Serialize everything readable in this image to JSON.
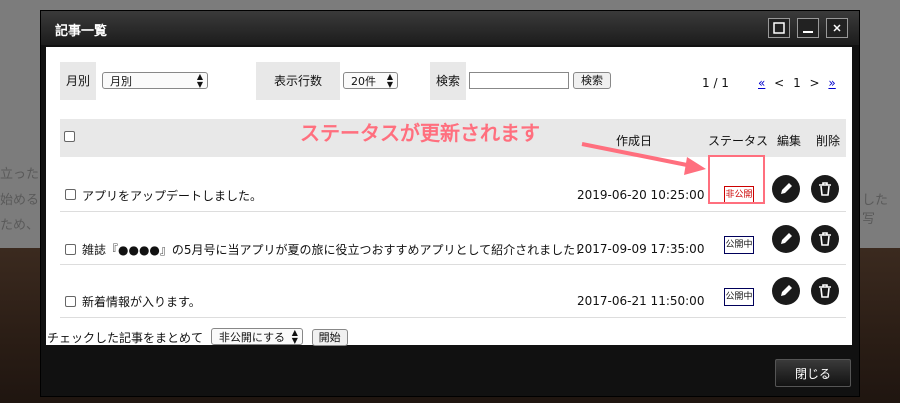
{
  "dialog": {
    "title": "記事一覧",
    "close_button": "閉じる",
    "window_buttons": [
      "maximize",
      "minimize",
      "close"
    ]
  },
  "filters": {
    "month_label": "月別",
    "month_value": "月別",
    "per_page_label": "表示行数",
    "per_page_value": "20件",
    "search_label": "検索",
    "search_value": "",
    "search_button": "検索",
    "page_info": "1 / 1",
    "pager": {
      "first": "«",
      "prev": "<",
      "current": "1",
      "next": ">",
      "last": "»"
    }
  },
  "table": {
    "headers": {
      "created": "作成日",
      "status": "ステータス",
      "edit": "編集",
      "delete": "削除"
    },
    "rows": [
      {
        "title": "アプリをアップデートしました。",
        "date": "2019-06-20 10:25:00",
        "status": "非公開"
      },
      {
        "title": "雑誌『●●●●』の5月号に当アプリが夏の旅に役立つおすすめアプリとして紹介されました！",
        "date": "2017-09-09 17:35:00",
        "status": "公開中"
      },
      {
        "title": "新着情報が入ります。",
        "date": "2017-06-21 11:50:00",
        "status": "公開中"
      }
    ]
  },
  "bulk": {
    "label": "チェックした記事をまとめて",
    "action_value": "非公開にする",
    "start_button": "開始"
  },
  "annotation": {
    "text": "ステータスが更新されます",
    "color": "#ff6f7e"
  },
  "background": {
    "line1": "立った",
    "line2": "始める",
    "line3": "ため、",
    "right": "した写"
  }
}
